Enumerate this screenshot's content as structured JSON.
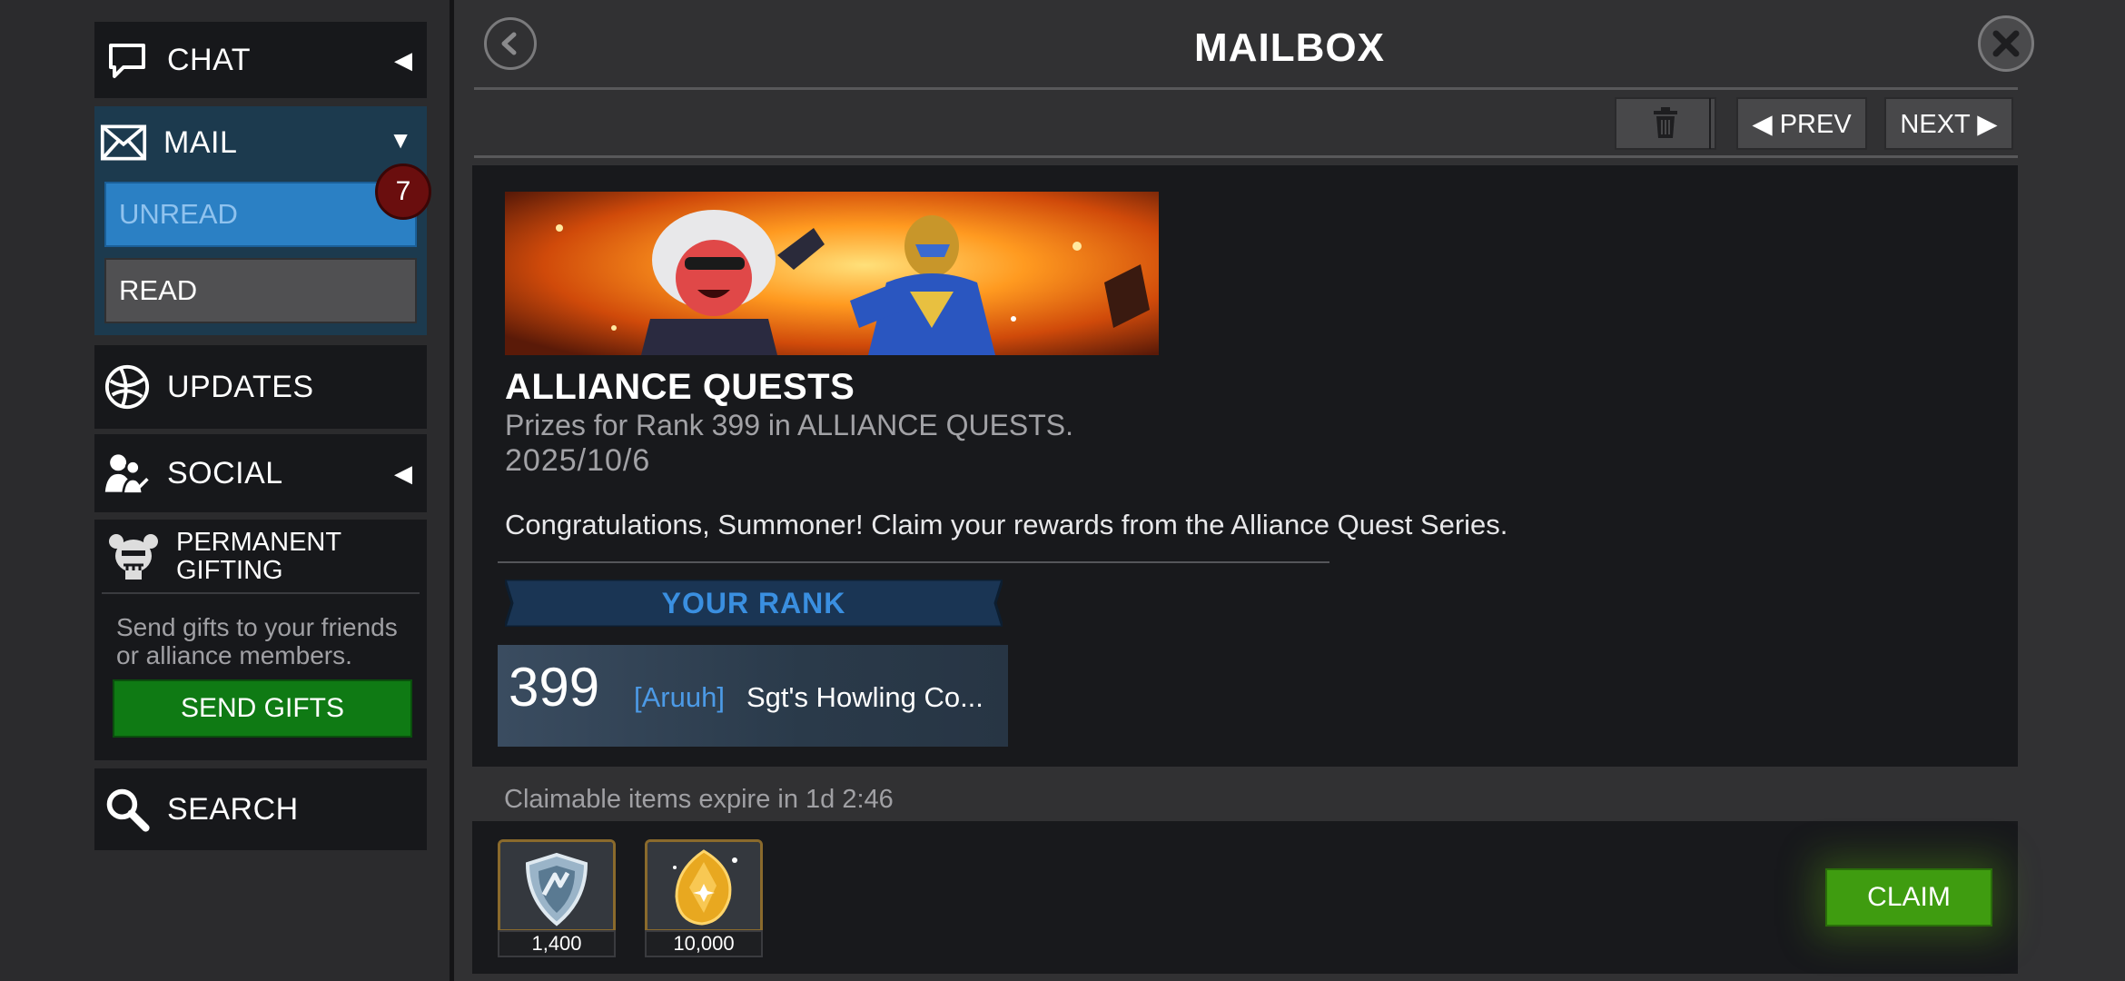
{
  "sidebar": {
    "chat": {
      "label": "CHAT",
      "arrow": "◀"
    },
    "mail": {
      "label": "MAIL",
      "arrow": "▼",
      "unread_label": "UNREAD",
      "read_label": "READ",
      "unread_count": "7"
    },
    "updates": {
      "label": "UPDATES"
    },
    "social": {
      "label": "SOCIAL",
      "arrow": "◀"
    },
    "gifting": {
      "title": "PERMANENT GIFTING",
      "description": "Send gifts to your friends or alliance members.",
      "send_label": "SEND GIFTS"
    },
    "search": {
      "label": "SEARCH"
    }
  },
  "header": {
    "title": "MAILBOX"
  },
  "toolbar": {
    "prev_label": "◀ PREV",
    "next_label": "NEXT ▶"
  },
  "message": {
    "title": "ALLIANCE QUESTS",
    "subtitle": "Prizes for Rank 399 in ALLIANCE QUESTS.",
    "date": "2025/10/6",
    "body": "Congratulations, Summoner! Claim your rewards from the Alliance Quest Series.",
    "rank_header": "YOUR RANK",
    "rank": {
      "number": "399",
      "tag": "[Aruuh]",
      "name": "Sgt's Howling Co..."
    }
  },
  "rewards": {
    "expire_text": "Claimable items expire in 1d 2:46",
    "items": [
      {
        "icon": "alliance-shield-icon",
        "count": "1,400"
      },
      {
        "icon": "gold-crystal-icon",
        "count": "10,000"
      }
    ],
    "claim_label": "CLAIM"
  },
  "colors": {
    "unread": "#2b80c4",
    "send_gifts": "#0f7a14",
    "claim": "#3f9c10",
    "rank_text": "#3a8fe0",
    "badge": "#6a0e0e"
  }
}
